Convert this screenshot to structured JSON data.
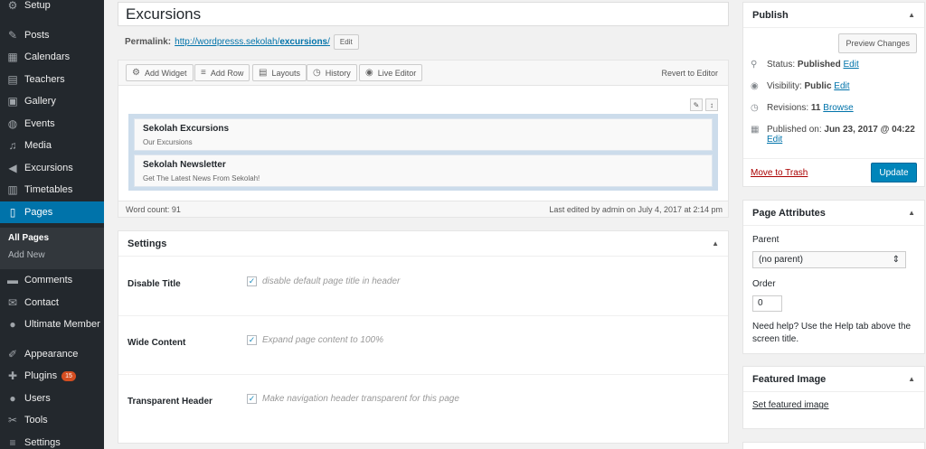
{
  "sidebar": {
    "items": [
      {
        "label": "Setup",
        "icon": "gear-icon",
        "glyph": "⚙"
      },
      {
        "label": "Posts",
        "icon": "pin-icon",
        "glyph": "✎"
      },
      {
        "label": "Calendars",
        "icon": "calendar-icon",
        "glyph": "▦"
      },
      {
        "label": "Teachers",
        "icon": "contacts-icon",
        "glyph": "▤"
      },
      {
        "label": "Gallery",
        "icon": "gallery-icon",
        "glyph": "▣"
      },
      {
        "label": "Events",
        "icon": "globe-icon",
        "glyph": "◍"
      },
      {
        "label": "Media",
        "icon": "media-icon",
        "glyph": "♫"
      },
      {
        "label": "Excursions",
        "icon": "megaphone-icon",
        "glyph": "◀"
      },
      {
        "label": "Timetables",
        "icon": "table-icon",
        "glyph": "▥"
      },
      {
        "label": "Pages",
        "icon": "pages-icon",
        "glyph": "▯"
      },
      {
        "label": "Comments",
        "icon": "comment-icon",
        "glyph": "▬"
      },
      {
        "label": "Contact",
        "icon": "mail-icon",
        "glyph": "✉"
      },
      {
        "label": "Ultimate Member",
        "icon": "user-icon",
        "glyph": "●"
      },
      {
        "label": "Appearance",
        "icon": "brush-icon",
        "glyph": "✐"
      },
      {
        "label": "Plugins",
        "icon": "plugin-icon",
        "glyph": "✚",
        "badge": "15"
      },
      {
        "label": "Users",
        "icon": "users-icon",
        "glyph": "●"
      },
      {
        "label": "Tools",
        "icon": "wrench-icon",
        "glyph": "✂"
      },
      {
        "label": "Settings",
        "icon": "settings-icon",
        "glyph": "≡"
      }
    ],
    "submenu": {
      "all_pages": "All Pages",
      "add_new": "Add New"
    }
  },
  "editor": {
    "title": "Excursions",
    "permalink_label": "Permalink:",
    "permalink_base": "http://wordpresss.sekolah/",
    "permalink_slug": "excursions",
    "permalink_tail": "/",
    "edit_label": "Edit"
  },
  "builder": {
    "toolbar": {
      "add_widget": "Add Widget",
      "add_row": "Add Row",
      "layouts": "Layouts",
      "history": "History",
      "live_editor": "Live Editor",
      "revert": "Revert to Editor"
    },
    "widgets": [
      {
        "title": "Sekolah Excursions",
        "desc": "Our Excursions"
      },
      {
        "title": "Sekolah Newsletter",
        "desc": "Get The Latest News From Sekolah!"
      }
    ],
    "word_count": "Word count: 91",
    "last_edited": "Last edited by admin on July 4, 2017 at 2:14 pm"
  },
  "settings": {
    "title": "Settings",
    "rows": [
      {
        "label": "Disable Title",
        "desc": "disable default page title in header"
      },
      {
        "label": "Wide Content",
        "desc": "Expand page content to 100%"
      },
      {
        "label": "Transparent Header",
        "desc": "Make navigation header transparent for this page"
      }
    ]
  },
  "publish": {
    "title": "Publish",
    "preview": "Preview Changes",
    "status_label": "Status:",
    "status_value": "Published",
    "visibility_label": "Visibility:",
    "visibility_value": "Public",
    "revisions_label": "Revisions:",
    "revisions_value": "11",
    "browse": "Browse",
    "published_on_label": "Published on:",
    "published_on_value": "Jun 23, 2017 @ 04:22",
    "edit": "Edit",
    "trash": "Move to Trash",
    "update": "Update"
  },
  "attributes": {
    "title": "Page Attributes",
    "parent_label": "Parent",
    "parent_value": "(no parent)",
    "order_label": "Order",
    "order_value": "0",
    "help_line1": "Need help? Use the Help tab above the",
    "help_line2": "screen title."
  },
  "featured": {
    "title": "Featured Image",
    "link": "Set featured image"
  }
}
